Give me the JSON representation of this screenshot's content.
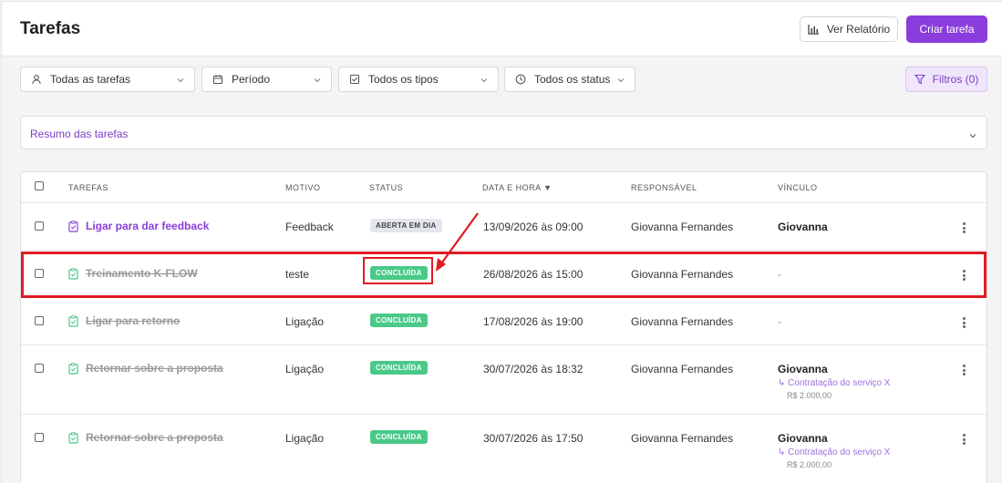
{
  "header": {
    "title": "Tarefas",
    "report_label": "Ver Relatório",
    "create_label": "Criar tarefa"
  },
  "filters": {
    "tasks": "Todas as tarefas",
    "period": "Período",
    "types": "Todos os tipos",
    "status": "Todos os status",
    "filtros_label": "Filtros (0)"
  },
  "resumo": {
    "label": "Resumo das tarefas"
  },
  "table": {
    "columns": {
      "tarefas": "TAREFAS",
      "motivo": "MOTIVO",
      "status": "STATUS",
      "data": "DATA E HORA ▼",
      "responsavel": "RESPONSÁVEL",
      "vinculo": "VÍNCULO"
    },
    "rows": [
      {
        "task": "Ligar para dar feedback",
        "motivo": "Feedback",
        "status": "ABERTA EM DIA",
        "data": "13/09/2026 às 09:00",
        "responsavel": "Giovanna Fernandes",
        "vinculo": "Giovanna",
        "link": "",
        "valor": ""
      },
      {
        "task": "Treinamento K-FLOW",
        "motivo": "teste",
        "status": "CONCLUÍDA",
        "data": "26/08/2026 às 15:00",
        "responsavel": "Giovanna Fernandes",
        "vinculo": "-",
        "link": "",
        "valor": ""
      },
      {
        "task": "Ligar para retorno",
        "motivo": "Ligação",
        "status": "CONCLUÍDA",
        "data": "17/08/2026 às 19:00",
        "responsavel": "Giovanna Fernandes",
        "vinculo": "-",
        "link": "",
        "valor": ""
      },
      {
        "task": "Retornar sobre a proposta",
        "motivo": "Ligação",
        "status": "CONCLUÍDA",
        "data": "30/07/2026 às 18:32",
        "responsavel": "Giovanna Fernandes",
        "vinculo": "Giovanna",
        "link": "↳ Contratação do serviço X",
        "valor": "R$ 2.000,00"
      },
      {
        "task": "Retornar sobre a proposta",
        "motivo": "Ligação",
        "status": "CONCLUÍDA",
        "data": "30/07/2026 às 17:50",
        "responsavel": "Giovanna Fernandes",
        "vinculo": "Giovanna",
        "link": "↳ Contratação do serviço X",
        "valor": "R$ 2.000,00"
      }
    ]
  },
  "colors": {
    "accent": "#8a3ddc",
    "done": "#4ac989",
    "annotation": "#e01b22"
  }
}
